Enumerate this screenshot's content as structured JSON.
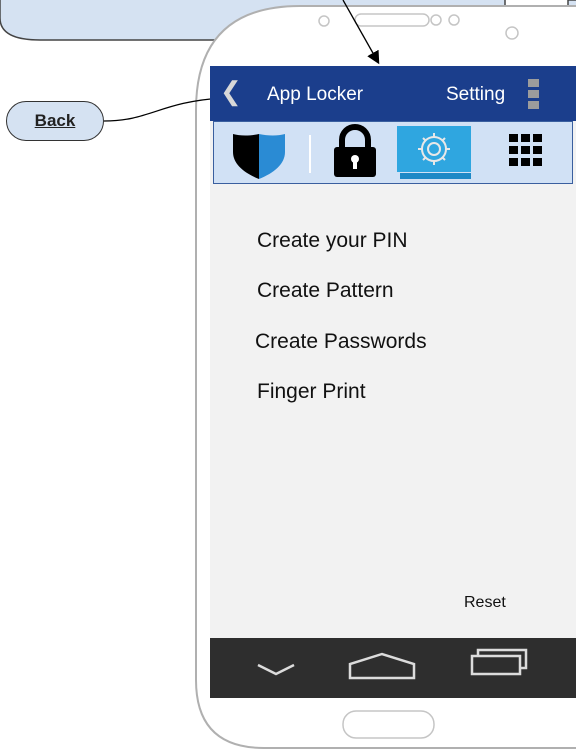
{
  "callouts": {
    "back_label": "Back"
  },
  "app": {
    "title": "App Locker",
    "setting_label": "Setting",
    "back_icon": "chevron-left-icon"
  },
  "tabs": [
    {
      "icon": "shield-icon",
      "selected": false
    },
    {
      "icon": "lock-icon",
      "selected": false
    },
    {
      "icon": "gear-icon",
      "selected": true
    },
    {
      "icon": "grid-icon",
      "selected": false
    }
  ],
  "menu": {
    "items": [
      "Create your PIN",
      "Create Pattern",
      "Create Passwords",
      "Finger Print"
    ],
    "reset_label": "Reset"
  },
  "navbar": {
    "icons": [
      "back-icon",
      "home-icon",
      "recent-apps-icon"
    ]
  },
  "colors": {
    "app_bar": "#1b3e8c",
    "tab_bar": "#d1e1f5",
    "tab_selected": "#2fa6e0",
    "screen_bg": "#f2f2f2",
    "nav_bar": "#2e2e2e",
    "callout": "#d5e2f2"
  }
}
